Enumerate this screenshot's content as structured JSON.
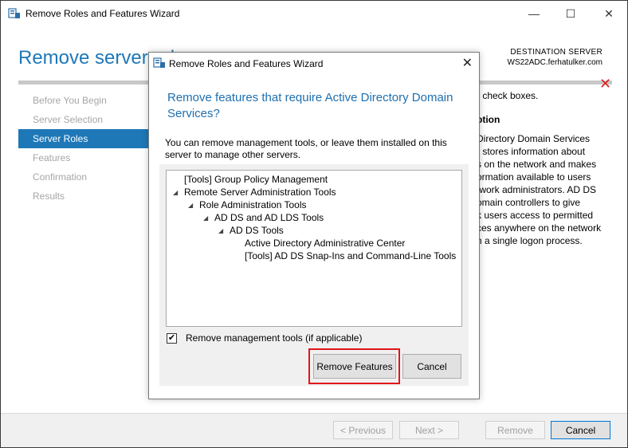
{
  "window": {
    "title": "Remove Roles and Features Wizard",
    "minimize_glyph": "—",
    "maximize_glyph": "☐",
    "close_glyph": "✕"
  },
  "main": {
    "header": "Remove server roles",
    "destination_label": "DESTINATION SERVER",
    "destination_server": "WS22ADC.ferhatulker.com",
    "close_glyph": "✕",
    "nav": [
      {
        "label": "Before You Begin",
        "state": "disabled"
      },
      {
        "label": "Server Selection",
        "state": "disabled"
      },
      {
        "label": "Server Roles",
        "state": "active"
      },
      {
        "label": "Features",
        "state": "disabled"
      },
      {
        "label": "Confirmation",
        "state": "disabled"
      },
      {
        "label": "Results",
        "state": "disabled"
      }
    ],
    "right_visible_text": {
      "line1": "r check boxes.",
      "heading": "ption",
      "lines": [
        "Directory Domain Services",
        ") stores information about",
        "s on the network and makes",
        "ormation available to users",
        "twork administrators. AD DS",
        "omain controllers to give",
        "k users access to permitted",
        "ces anywhere on the network",
        "h a single logon process."
      ]
    }
  },
  "footer": {
    "previous": "< Previous",
    "next": "Next >",
    "remove": "Remove",
    "cancel": "Cancel"
  },
  "dialog": {
    "title": "Remove Roles and Features Wizard",
    "close_glyph": "✕",
    "heading": "Remove features that require Active Directory Domain Services?",
    "info": "You can remove management tools, or leave them installed on this server to manage other servers.",
    "tree": [
      {
        "label": "[Tools] Group Policy Management",
        "level": 0,
        "expanded": null
      },
      {
        "label": "Remote Server Administration Tools",
        "level": 0,
        "expanded": true
      },
      {
        "label": "Role Administration Tools",
        "level": 1,
        "expanded": true
      },
      {
        "label": "AD DS and AD LDS Tools",
        "level": 2,
        "expanded": true
      },
      {
        "label": "AD DS Tools",
        "level": 3,
        "expanded": true
      },
      {
        "label": "Active Directory Administrative Center",
        "level": 4,
        "expanded": null
      },
      {
        "label": "[Tools] AD DS Snap-Ins and Command-Line Tools",
        "level": 4,
        "expanded": null
      }
    ],
    "checkbox_label": "Remove management tools (if applicable)",
    "checkbox_checked": true,
    "checkbox_glyph": "✔",
    "remove_features": "Remove Features",
    "cancel": "Cancel"
  },
  "colors": {
    "accent": "#1e78b8",
    "highlight": "#e3141b",
    "close_red": "#d42323"
  }
}
